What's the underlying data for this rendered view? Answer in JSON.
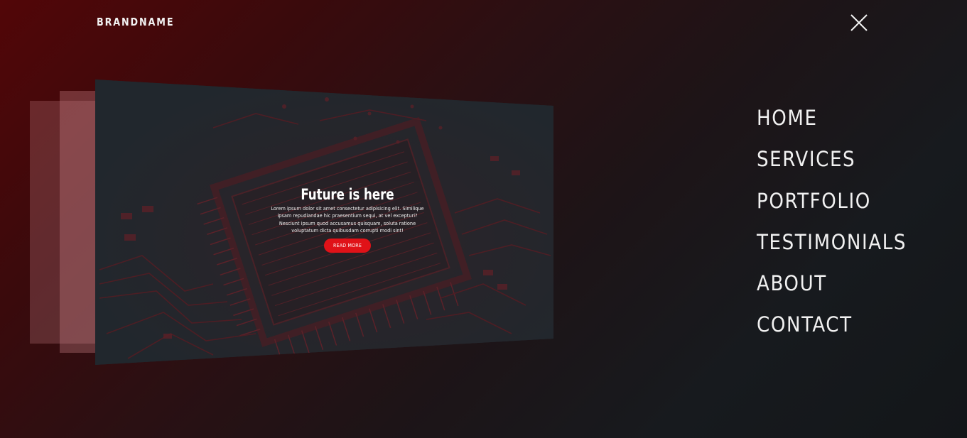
{
  "header": {
    "brand": "BRANDNAME",
    "close_icon": "close-icon"
  },
  "card": {
    "title": "Future is here",
    "body": "Lorem ipsum dolor sit amet consectetur adipisicing elit. Similique ipsam repudiandae hic praesentium sequi, at vel excepturi? Nesciunt ipsum quod accusamus quisquam, soluta ratione voluptatum dicta quibusdam corrupti modi sint!",
    "button_label": "READ MORE",
    "background": "circuit-board-image"
  },
  "nav": {
    "items": [
      {
        "label": "HOME"
      },
      {
        "label": "SERVICES"
      },
      {
        "label": "PORTFOLIO"
      },
      {
        "label": "TESTIMONIALS"
      },
      {
        "label": "ABOUT"
      },
      {
        "label": "CONTACT"
      }
    ]
  },
  "colors": {
    "accent": "#e01218",
    "background_dark": "#131619",
    "background_red": "#520608",
    "text": "#f1f1f1"
  }
}
